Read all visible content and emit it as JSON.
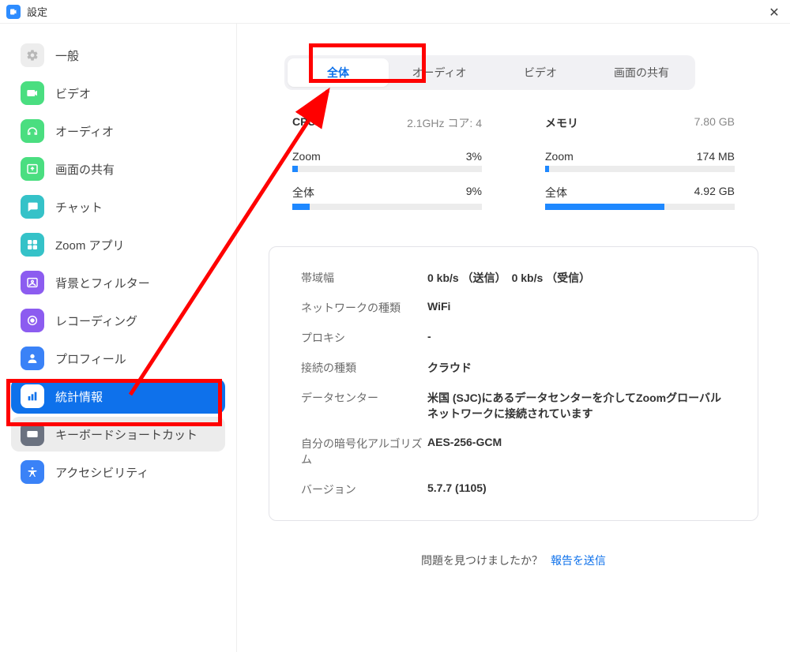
{
  "window": {
    "title": "設定"
  },
  "sidebar": {
    "items": [
      {
        "id": "general",
        "label": "一般",
        "iconBg": "#EDEDED",
        "iconFg": "#B8B8B8"
      },
      {
        "id": "video",
        "label": "ビデオ",
        "iconBg": "#4ADE80",
        "iconFg": "#FFFFFF"
      },
      {
        "id": "audio",
        "label": "オーディオ",
        "iconBg": "#4ADE80",
        "iconFg": "#FFFFFF"
      },
      {
        "id": "share",
        "label": "画面の共有",
        "iconBg": "#4ADE80",
        "iconFg": "#FFFFFF"
      },
      {
        "id": "chat",
        "label": "チャット",
        "iconBg": "#35C2C8",
        "iconFg": "#FFFFFF"
      },
      {
        "id": "apps",
        "label": "Zoom アプリ",
        "iconBg": "#35C2C8",
        "iconFg": "#FFFFFF"
      },
      {
        "id": "background",
        "label": "背景とフィルター",
        "iconBg": "#8C5CF0",
        "iconFg": "#FFFFFF"
      },
      {
        "id": "recording",
        "label": "レコーディング",
        "iconBg": "#8C5CF0",
        "iconFg": "#FFFFFF"
      },
      {
        "id": "profile",
        "label": "プロフィール",
        "iconBg": "#3A82F7",
        "iconFg": "#FFFFFF"
      },
      {
        "id": "stats",
        "label": "統計情報",
        "iconBg": "#FFFFFF",
        "iconFg": "#0E71EB"
      },
      {
        "id": "keyboard",
        "label": "キーボードショートカット",
        "iconBg": "#6B7280",
        "iconFg": "#FFFFFF"
      },
      {
        "id": "accessibility",
        "label": "アクセシビリティ",
        "iconBg": "#3A82F7",
        "iconFg": "#FFFFFF"
      }
    ],
    "selectedId": "stats",
    "hoverId": "keyboard"
  },
  "tabs": {
    "items": [
      {
        "id": "overall",
        "label": "全体"
      },
      {
        "id": "audio",
        "label": "オーディオ"
      },
      {
        "id": "video",
        "label": "ビデオ"
      },
      {
        "id": "share",
        "label": "画面の共有"
      }
    ],
    "activeId": "overall"
  },
  "metrics": {
    "cpu": {
      "title": "CPU",
      "subtitle": "2.1GHz  コア: 4",
      "rows": [
        {
          "label": "Zoom",
          "display": "3%",
          "pct": 3
        },
        {
          "label": "全体",
          "display": "9%",
          "pct": 9
        }
      ]
    },
    "memory": {
      "title": "メモリ",
      "subtitle": "7.80 GB",
      "rows": [
        {
          "label": "Zoom",
          "display": "174 MB",
          "pct": 2
        },
        {
          "label": "全体",
          "display": "4.92 GB",
          "pct": 63
        }
      ]
    }
  },
  "info": {
    "rows": [
      {
        "key": "帯域幅",
        "val": "0 kb/s （送信）　0 kb/s （受信）"
      },
      {
        "key": "ネットワークの種類",
        "val": "WiFi"
      },
      {
        "key": "プロキシ",
        "val": "-"
      },
      {
        "key": "接続の種類",
        "val": "クラウド"
      },
      {
        "key": "データセンター",
        "val": "米国 (SJC)にあるデータセンターを介してZoomグローバルネットワークに接続されています"
      },
      {
        "key": "自分の暗号化アルゴリズム",
        "val": "AES-256-GCM"
      },
      {
        "key": "バージョン",
        "val": "5.7.7 (1105)"
      }
    ]
  },
  "footer": {
    "question": "問題を見つけましたか？",
    "link": "報告を送信"
  }
}
